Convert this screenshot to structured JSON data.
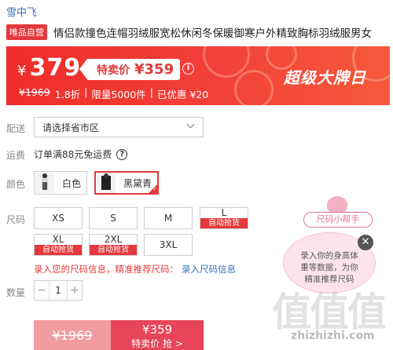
{
  "brand": "雪中飞",
  "product": {
    "badge": "唯品自营",
    "title": "情侣款撞色连帽羽绒服宽松休闲冬保暖御寒户外精致胸标羽绒服男女"
  },
  "banner": {
    "currency": "¥",
    "price": "379",
    "flash_label": "特卖价",
    "flash_price": "¥359",
    "original_price": "¥1969",
    "discount": "1.8折",
    "limit": "限量5000件",
    "saved": "已优惠 ¥20",
    "separator": "|",
    "super_brand": "超级大牌日",
    "info_icon": "i"
  },
  "delivery": {
    "label": "配送",
    "placeholder": "请选择省市区"
  },
  "shipping": {
    "label": "运费",
    "text": "订单满88元免运费",
    "help_icon": "?"
  },
  "colors": {
    "label": "颜色",
    "options": [
      {
        "name": "白色",
        "selected": false
      },
      {
        "name": "黑黛青",
        "selected": true
      }
    ]
  },
  "sizes": {
    "label": "尺码",
    "options": [
      {
        "size": "XS",
        "auto": ""
      },
      {
        "size": "S",
        "auto": ""
      },
      {
        "size": "M",
        "auto": ""
      },
      {
        "size": "L",
        "auto": "自动抢货"
      },
      {
        "size": "XL",
        "auto": "自动抢货"
      },
      {
        "size": "2XL",
        "auto": "自动抢货"
      },
      {
        "size": "3XL",
        "auto": ""
      }
    ],
    "hint": "录入您的尺码信息，精准推荐尺码：",
    "hint_link": "录入尺码信息"
  },
  "quantity": {
    "label": "数量",
    "value": "1",
    "minus": "−",
    "plus": "+"
  },
  "buy": {
    "original": "¥1969",
    "flash_price": "¥359",
    "flash_label": "特卖价 抢 >"
  },
  "helper": {
    "title": "尺码小帮手",
    "line1": "录入你的身高体",
    "line2": "重等数据，为你",
    "line3": "精准推荐尺码",
    "close": "✕"
  },
  "watermark": {
    "text": "值值值",
    "url": "zhizhizhi.com"
  },
  "colors_theme": {
    "accent": "#e4393c",
    "link": "#3a6fb8",
    "pink": "#e4749a"
  }
}
